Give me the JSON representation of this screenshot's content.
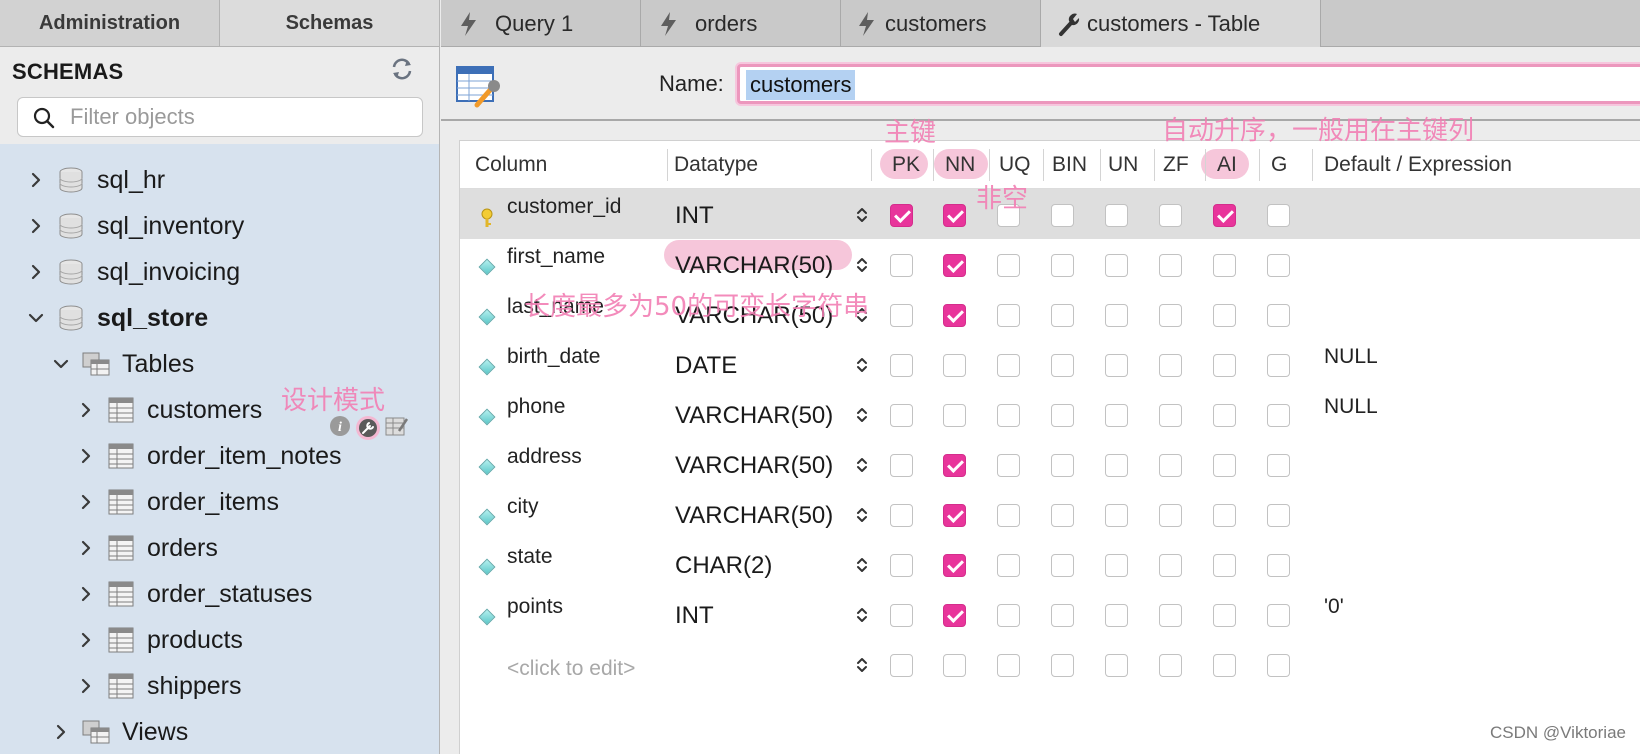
{
  "left_tabs": [
    "Administration",
    "Schemas"
  ],
  "schemas": {
    "title": "SCHEMAS",
    "filter_placeholder": "Filter objects",
    "databases": [
      "sql_hr",
      "sql_inventory",
      "sql_invoicing",
      "sql_store"
    ],
    "tables_label": "Tables",
    "tables": [
      "customers",
      "order_item_notes",
      "order_items",
      "orders",
      "order_statuses",
      "products",
      "shippers"
    ],
    "views_label": "Views"
  },
  "editor_tabs": [
    "Query 1",
    "orders",
    "customers",
    "customers - Table"
  ],
  "name_label": "Name:",
  "table_name": "customers",
  "headers": [
    "Column",
    "Datatype",
    "PK",
    "NN",
    "UQ",
    "BIN",
    "UN",
    "ZF",
    "AI",
    "G",
    "Default / Expression"
  ],
  "rows": [
    {
      "name": "customer_id",
      "type": "INT",
      "flags": [
        1,
        1,
        0,
        0,
        0,
        0,
        1,
        0
      ],
      "default": "",
      "key": true
    },
    {
      "name": "first_name",
      "type": "VARCHAR(50)",
      "flags": [
        0,
        1,
        0,
        0,
        0,
        0,
        0,
        0
      ],
      "default": ""
    },
    {
      "name": "last_name",
      "type": "VARCHAR(50)",
      "flags": [
        0,
        1,
        0,
        0,
        0,
        0,
        0,
        0
      ],
      "default": ""
    },
    {
      "name": "birth_date",
      "type": "DATE",
      "flags": [
        0,
        0,
        0,
        0,
        0,
        0,
        0,
        0
      ],
      "default": "NULL"
    },
    {
      "name": "phone",
      "type": "VARCHAR(50)",
      "flags": [
        0,
        0,
        0,
        0,
        0,
        0,
        0,
        0
      ],
      "default": "NULL"
    },
    {
      "name": "address",
      "type": "VARCHAR(50)",
      "flags": [
        0,
        1,
        0,
        0,
        0,
        0,
        0,
        0
      ],
      "default": ""
    },
    {
      "name": "city",
      "type": "VARCHAR(50)",
      "flags": [
        0,
        1,
        0,
        0,
        0,
        0,
        0,
        0
      ],
      "default": ""
    },
    {
      "name": "state",
      "type": "CHAR(2)",
      "flags": [
        0,
        1,
        0,
        0,
        0,
        0,
        0,
        0
      ],
      "default": ""
    },
    {
      "name": "points",
      "type": "INT",
      "flags": [
        0,
        1,
        0,
        0,
        0,
        0,
        0,
        0
      ],
      "default": "'0'"
    }
  ],
  "placeholder_row": "<click to edit>",
  "annotations": {
    "primary_key": "主键",
    "not_null": "非空",
    "auto_increment": "自动升序，一般用在主键列",
    "varchar": "长度最多为50的可变长字符串",
    "design_mode": "设计模式"
  },
  "watermark": "CSDN @Viktoriae",
  "colors": {
    "checkbox_on": "#e8359b",
    "highlight_pill": "#f6c6da",
    "annotation": "#f27fb4",
    "sidebar_bg": "#d7e2ee"
  }
}
